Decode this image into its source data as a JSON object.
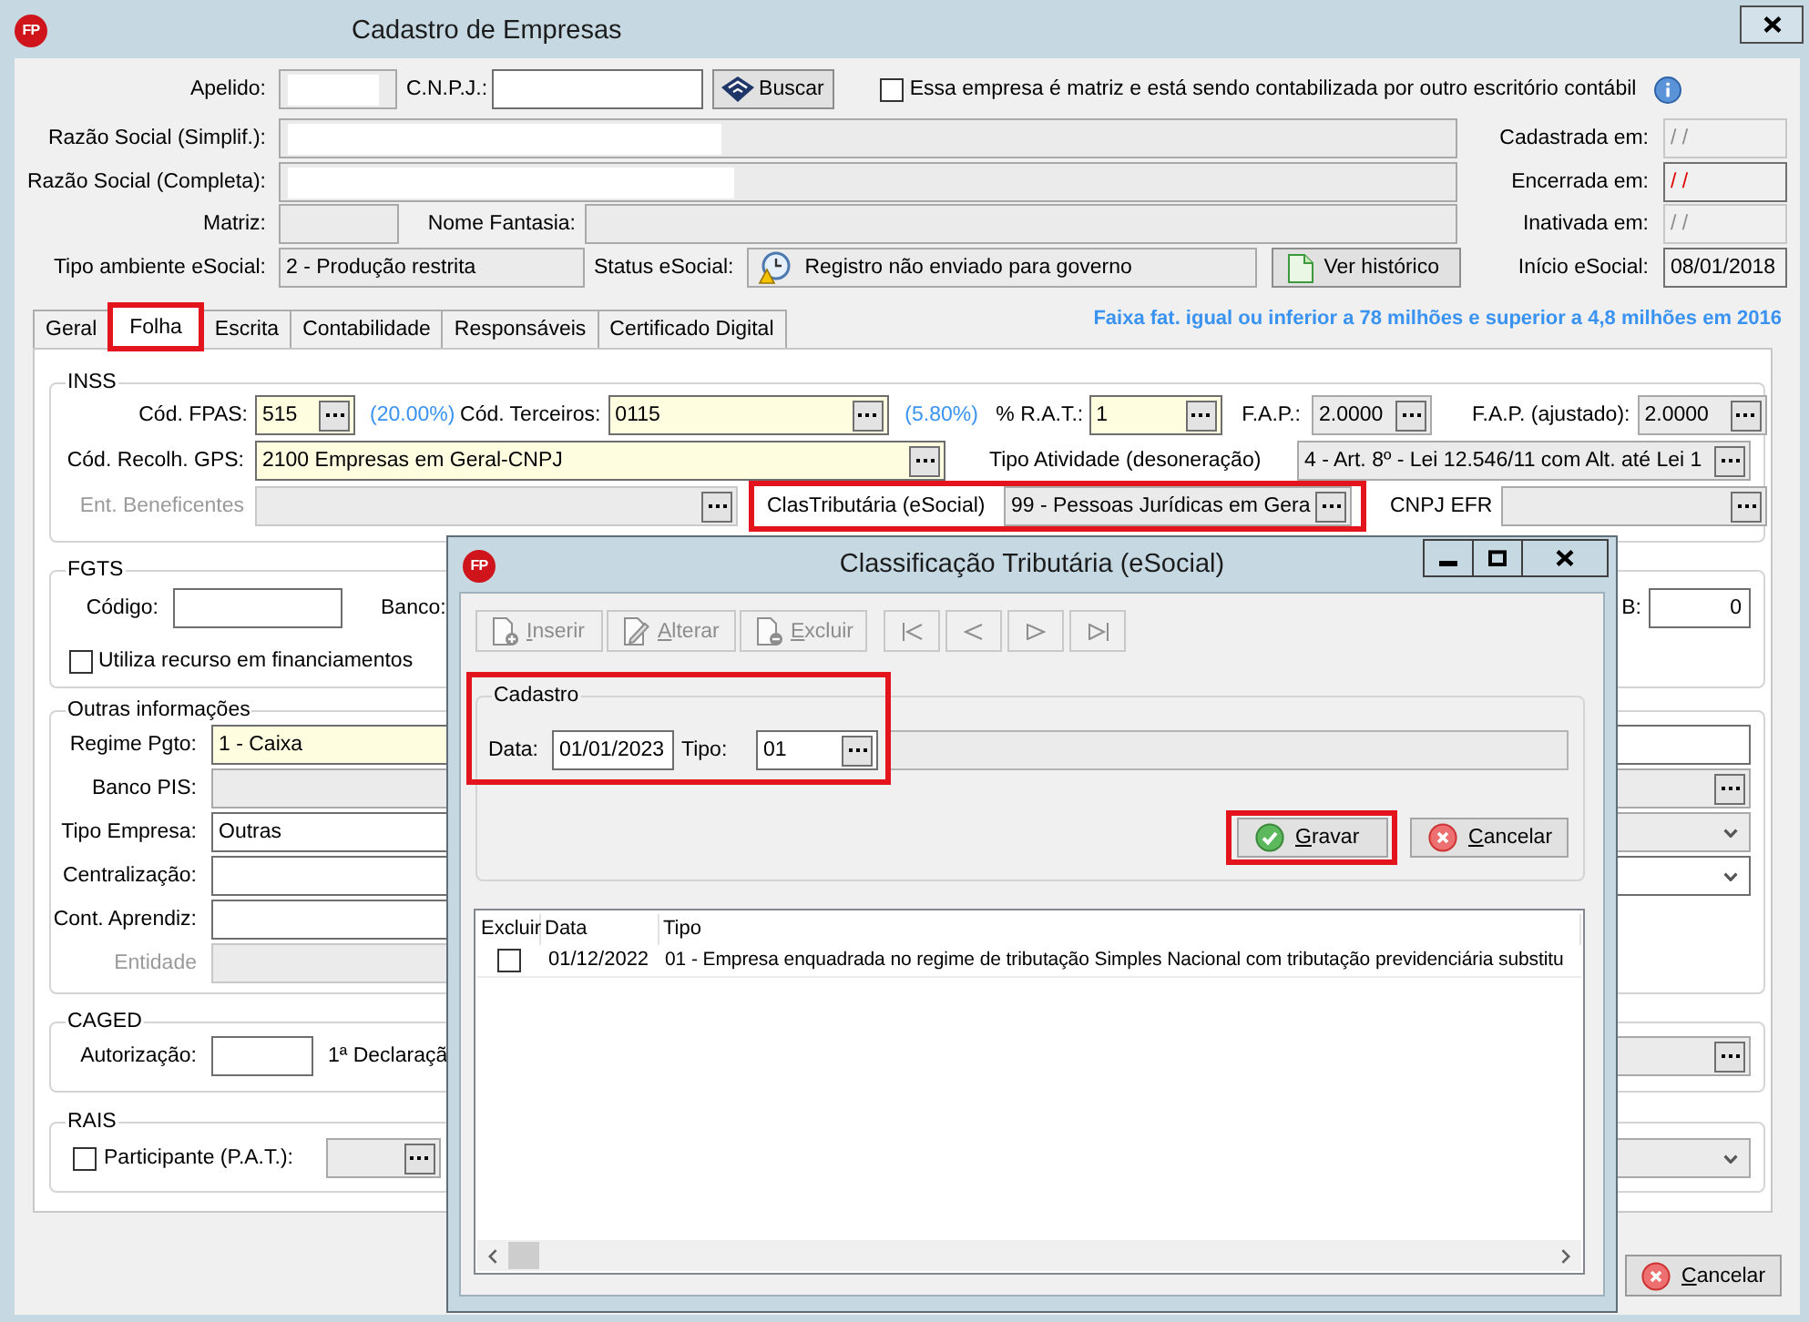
{
  "window": {
    "logo": "FP",
    "title": "Cadastro de Empresas"
  },
  "header": {
    "apelido": {
      "label": "Apelido:",
      "read_only": true,
      "redacted": true
    },
    "cnpj": {
      "label": "C.N.P.J.:",
      "read_only": false
    },
    "search_button": "Buscar",
    "matriz_option": {
      "label": "Essa empresa é matriz e está sendo contabilizada por outro escritório contábil",
      "checked": false
    },
    "razao_simplif": {
      "label": "Razão Social (Simplif.):",
      "read_only": true,
      "redacted": true
    },
    "razao_completa": {
      "label": "Razão Social (Completa):",
      "read_only": true,
      "redacted": true
    },
    "matriz": {
      "label": "Matriz:",
      "read_only": true
    },
    "nome_fantasia": {
      "label": "Nome Fantasia:",
      "read_only": true
    },
    "tipo_ambiente": {
      "label": "Tipo ambiente eSocial:",
      "value": "2 - Produção restrita",
      "read_only": true
    },
    "status_esocial": {
      "label": "Status eSocial:",
      "value": "Registro não enviado para governo",
      "read_only": true
    },
    "history_button": "Ver histórico",
    "dates": [
      {
        "label": "Cadastrada em:",
        "value": "/ /",
        "disabled": true,
        "alert": false
      },
      {
        "label": "Encerrada em:",
        "value": "/ /",
        "disabled": false,
        "alert": true
      },
      {
        "label": "Inativada em:",
        "value": "/ /",
        "disabled": true,
        "alert": false
      },
      {
        "label": "Início eSocial:",
        "value": "08/01/2018",
        "disabled": false,
        "alert": false
      }
    ]
  },
  "tabs": [
    {
      "label": "Geral",
      "selected": false,
      "highlighted": false
    },
    {
      "label": "Folha",
      "selected": true,
      "highlighted": true
    },
    {
      "label": "Escrita",
      "selected": false,
      "highlighted": false
    },
    {
      "label": "Contabilidade",
      "selected": false,
      "highlighted": false
    },
    {
      "label": "Responsáveis",
      "selected": false,
      "highlighted": false
    },
    {
      "label": "Certificado Digital",
      "selected": false,
      "highlighted": false
    }
  ],
  "tabs_note": "Faixa fat. igual ou inferior a 78 milhões e superior a 4,8 milhões em 2016",
  "inss": {
    "title": "INSS",
    "fields": [
      {
        "label": "Cód. FPAS:",
        "value": "515",
        "note": "(20.00%)",
        "kind": "lookup",
        "required": true,
        "read_only": false,
        "disabled": false,
        "highlighted": false
      },
      {
        "label": "Cód. Terceiros:",
        "value": "0115",
        "note": "(5.80%)",
        "kind": "lookup",
        "required": true,
        "read_only": false,
        "disabled": false,
        "highlighted": false
      },
      {
        "label": "% R.A.T.:",
        "value": "1",
        "kind": "lookup",
        "required": true,
        "read_only": false,
        "disabled": false,
        "highlighted": false
      },
      {
        "label": "F.A.P.:",
        "value": "2.0000",
        "kind": "lookup",
        "required": false,
        "read_only": true,
        "disabled": false,
        "highlighted": false
      },
      {
        "label": "F.A.P. (ajustado):",
        "value": "2.0000",
        "kind": "lookup",
        "required": false,
        "read_only": true,
        "disabled": false,
        "highlighted": false
      },
      {
        "label": "Cód. Recolh. GPS:",
        "value": "2100 Empresas em Geral-CNPJ",
        "kind": "lookup",
        "required": true,
        "read_only": false,
        "disabled": false,
        "highlighted": false
      },
      {
        "label": "Tipo Atividade (desoneração)",
        "value": "4 - Art. 8º - Lei 12.546/11 com Alt. até Lei 1",
        "kind": "lookup",
        "required": false,
        "read_only": true,
        "disabled": false,
        "highlighted": false
      },
      {
        "label": "Ent. Beneficentes",
        "kind": "lookup",
        "required": false,
        "read_only": true,
        "disabled": true,
        "highlighted": false
      },
      {
        "label": "ClasTributária (eSocial)",
        "value": "99 - Pessoas Jurídicas em Gera",
        "kind": "lookup",
        "required": false,
        "read_only": true,
        "disabled": false,
        "highlighted": true
      },
      {
        "label": "CNPJ EFR",
        "kind": "lookup",
        "required": false,
        "read_only": true,
        "disabled": false,
        "highlighted": false
      }
    ]
  },
  "fgts": {
    "title": "FGTS",
    "fields": [
      {
        "label": "Código:",
        "read_only": false
      }
    ],
    "cut_label": "Banco:",
    "right_field": {
      "label": "B:",
      "value": "0",
      "read_only": false
    },
    "option": {
      "label": "Utiliza recurso em financiamentos",
      "checked": false
    }
  },
  "outras": {
    "title": "Outras informações",
    "fields": [
      {
        "label": "Regime Pgto:",
        "value": "1 - Caixa",
        "required": true,
        "read_only": false,
        "disabled": false
      },
      {
        "label": "Banco PIS:",
        "required": false,
        "read_only": true,
        "disabled": false
      },
      {
        "label": "Tipo Empresa:",
        "value": "Outras",
        "required": false,
        "read_only": false,
        "disabled": false
      },
      {
        "label": "Centralização:",
        "required": false,
        "read_only": false,
        "disabled": false
      },
      {
        "label": "Cont. Aprendiz:",
        "required": false,
        "read_only": false,
        "disabled": false
      },
      {
        "label": "Entidade",
        "required": false,
        "read_only": true,
        "disabled": true
      }
    ],
    "right_fields": [
      {
        "kind": "input",
        "read_only": false
      },
      {
        "kind": "lookup",
        "read_only": true
      },
      {
        "kind": "dropdown",
        "read_only": true
      },
      {
        "kind": "dropdown",
        "read_only": false
      }
    ]
  },
  "caged": {
    "title": "CAGED",
    "fields": [
      {
        "label": "Autorização:",
        "read_only": false
      }
    ],
    "cut_label": "1ª Declaraçã",
    "right_fields": [
      {
        "kind": "lookup",
        "read_only": true
      }
    ]
  },
  "rais": {
    "title": "RAIS",
    "option": {
      "label": "Participante (P.A.T.):",
      "checked": false
    },
    "field": {
      "kind": "lookup",
      "read_only": true
    },
    "right_fields": [
      {
        "kind": "dropdown",
        "read_only": true
      }
    ]
  },
  "cancel_button": "Cancelar",
  "dialog": {
    "logo": "FP",
    "title": "Classificação Tributária (eSocial)",
    "toolbar": [
      {
        "label": "Inserir",
        "kind": "insert",
        "disabled": true
      },
      {
        "label": "Alterar",
        "kind": "edit",
        "disabled": true
      },
      {
        "label": "Excluir",
        "kind": "delete",
        "disabled": true
      }
    ],
    "navigation": [
      {
        "kind": "first",
        "disabled": true
      },
      {
        "kind": "previous",
        "disabled": true
      },
      {
        "kind": "next",
        "disabled": true
      },
      {
        "kind": "last",
        "disabled": true
      }
    ],
    "cadastro": {
      "title": "Cadastro",
      "highlighted": true,
      "data": {
        "label": "Data:",
        "value": "01/01/2023"
      },
      "tipo": {
        "label": "Tipo:",
        "value": "01"
      }
    },
    "buttons": [
      {
        "label": "Gravar",
        "kind": "save",
        "highlighted": true
      },
      {
        "label": "Cancelar",
        "kind": "cancel",
        "highlighted": false
      }
    ],
    "grid": {
      "columns": [
        "Excluir",
        "Data",
        "Tipo"
      ],
      "rows": [
        {
          "checked": false,
          "data": "01/12/2022",
          "tipo": "01 - Empresa enquadrada no regime de tributação Simples Nacional com tributação previdenciária substitu"
        }
      ]
    }
  }
}
